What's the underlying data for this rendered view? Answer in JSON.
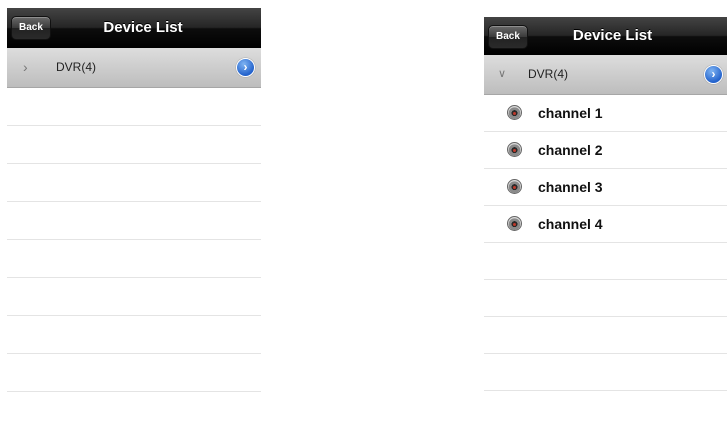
{
  "left_screen": {
    "navbar": {
      "back_label": "Back",
      "title": "Device List"
    },
    "group": {
      "disclosure_icon": "chevron-right-icon",
      "label": "DVR(4)",
      "detail_icon": "detail-disclosure-icon",
      "expanded": false
    },
    "empty_rows": 8
  },
  "right_screen": {
    "navbar": {
      "back_label": "Back",
      "title": "Device List"
    },
    "group": {
      "disclosure_icon": "chevron-down-icon",
      "label": "DVR(4)",
      "detail_icon": "detail-disclosure-icon",
      "expanded": true
    },
    "channels": [
      {
        "label": "channel 1",
        "icon": "camera-icon"
      },
      {
        "label": "channel 2",
        "icon": "camera-icon"
      },
      {
        "label": "channel 3",
        "icon": "camera-icon"
      },
      {
        "label": "channel 4",
        "icon": "camera-icon"
      }
    ],
    "empty_rows": 5
  },
  "colors": {
    "navbar": "#000000",
    "group_row": "#cccccc",
    "detail_button": "#2463cc",
    "row_separator": "#e4e4e4"
  }
}
